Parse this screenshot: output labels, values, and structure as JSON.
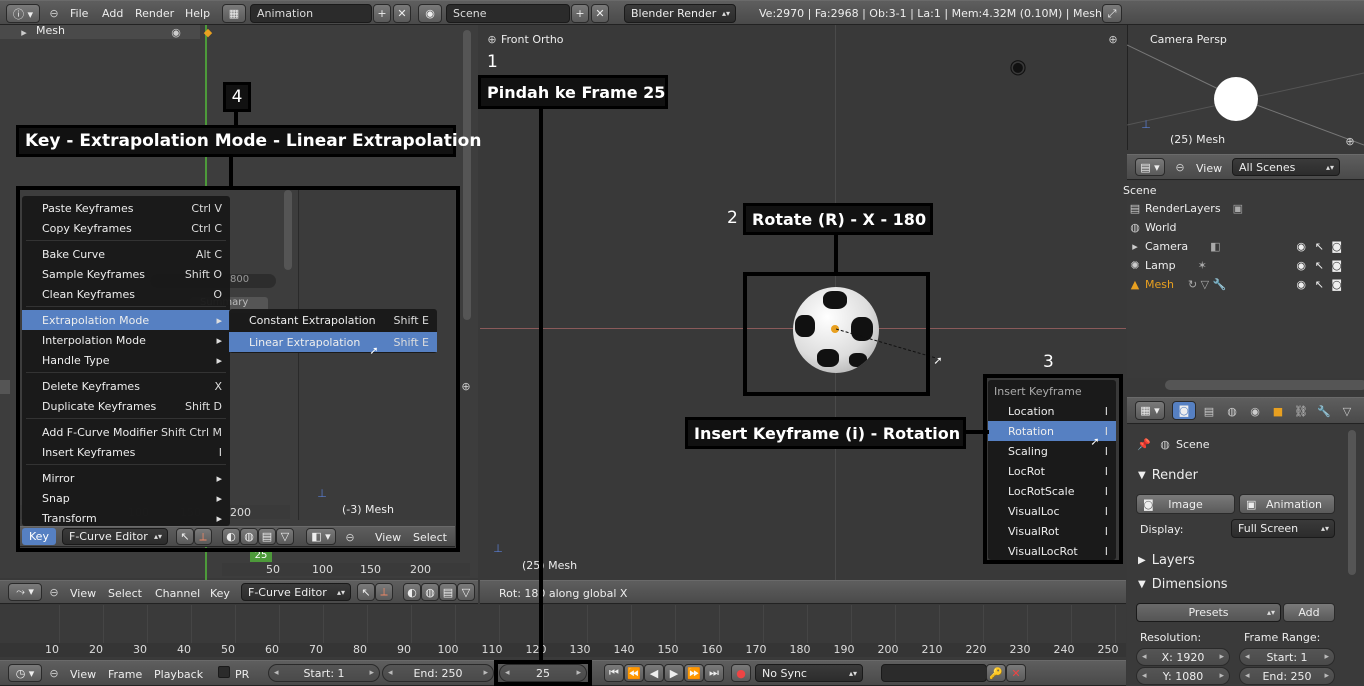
{
  "topbar": {
    "menus": [
      "File",
      "Add",
      "Render",
      "Help"
    ],
    "screen_layout": "Animation",
    "scene": "Scene",
    "engine": "Blender Render",
    "stats": "Ve:2970 | Fa:2968 | Ob:3-1 | La:1 | Mem:4.32M (0.10M) | Mesh"
  },
  "graph_editor": {
    "outliner_item": "Mesh",
    "left_label": "(-3) Mesh",
    "small_ticks_a": [
      "100",
      "150",
      "200"
    ],
    "small_fields": [
      "800",
      "Summary"
    ],
    "header": {
      "key_label": "Key",
      "editor_type": "F-Curve Editor",
      "menus": [
        "View",
        "Select"
      ]
    },
    "main_header": {
      "menus": [
        "View",
        "Select",
        "Channel",
        "Key"
      ],
      "editor_type": "F-Curve Editor"
    },
    "ruler": [
      "50",
      "100",
      "150",
      "200"
    ],
    "current_frame_badge": "25"
  },
  "key_menu": {
    "items": [
      {
        "label": "Paste Keyframes",
        "shortcut": "Ctrl V"
      },
      {
        "label": "Copy Keyframes",
        "shortcut": "Ctrl C"
      },
      {
        "label": "Bake Curve",
        "shortcut": "Alt C"
      },
      {
        "label": "Sample Keyframes",
        "shortcut": "Shift O"
      },
      {
        "label": "Clean Keyframes",
        "shortcut": "O"
      },
      {
        "label": "Extrapolation Mode",
        "shortcut": ""
      },
      {
        "label": "Interpolation Mode",
        "shortcut": ""
      },
      {
        "label": "Handle Type",
        "shortcut": ""
      },
      {
        "label": "Delete Keyframes",
        "shortcut": "X"
      },
      {
        "label": "Duplicate Keyframes",
        "shortcut": "Shift D"
      },
      {
        "label": "Add F-Curve Modifier",
        "shortcut": "Shift Ctrl M"
      },
      {
        "label": "Insert Keyframes",
        "shortcut": "I"
      },
      {
        "label": "Mirror",
        "shortcut": ""
      },
      {
        "label": "Snap",
        "shortcut": ""
      },
      {
        "label": "Transform",
        "shortcut": ""
      }
    ],
    "submenu": [
      {
        "label": "Constant Extrapolation",
        "shortcut": "Shift E"
      },
      {
        "label": "Linear Extrapolation",
        "shortcut": "Shift E"
      }
    ]
  },
  "viewport": {
    "title": "Front Ortho",
    "object_label": "(25) Mesh",
    "status": "Rot: 180  along global X"
  },
  "insert_keyframe_menu": {
    "title": "Insert Keyframe",
    "items": [
      {
        "label": "Location",
        "shortcut": "I"
      },
      {
        "label": "Rotation",
        "shortcut": "I"
      },
      {
        "label": "Scaling",
        "shortcut": "I"
      },
      {
        "label": "LocRot",
        "shortcut": "I"
      },
      {
        "label": "LocRotScale",
        "shortcut": "I"
      },
      {
        "label": "VisualLoc",
        "shortcut": "I"
      },
      {
        "label": "VisualRot",
        "shortcut": "I"
      },
      {
        "label": "VisualLocRot",
        "shortcut": "I"
      }
    ]
  },
  "callouts": {
    "c1_num": "1",
    "c1": "Pindah ke Frame 25",
    "c2_num": "2",
    "c2": "Rotate (R) - X - 180",
    "c3_num": "3",
    "c3": "Insert Keyframe (i) - Rotation",
    "c4_num": "4",
    "c4": "Key - Extrapolation Mode - Linear Extrapolation"
  },
  "camera_view": {
    "title": "Camera Persp",
    "label": "(25) Mesh"
  },
  "outliner": {
    "view": "View",
    "filter": "All Scenes",
    "scene": "Scene",
    "items": [
      "RenderLayers",
      "World",
      "Camera",
      "Lamp",
      "Mesh"
    ]
  },
  "properties": {
    "scene": "Scene",
    "render_panel": "Render",
    "image_btn": "Image",
    "animation_btn": "Animation",
    "display_label": "Display:",
    "display_value": "Full Screen",
    "layers_panel": "Layers",
    "dimensions_panel": "Dimensions",
    "presets": "Presets",
    "add": "Add",
    "resolution_label": "Resolution:",
    "frame_range_label": "Frame Range:",
    "res_x": "X: 1920",
    "res_y": "Y: 1080",
    "start_frame": "Start: 1",
    "end_frame": "End: 250"
  },
  "timeline": {
    "ticks": [
      "10",
      "20",
      "30",
      "40",
      "50",
      "60",
      "70",
      "80",
      "90",
      "100",
      "110",
      "120",
      "130",
      "140",
      "150",
      "160",
      "170",
      "180",
      "190",
      "200",
      "210",
      "220",
      "230",
      "240",
      "250"
    ],
    "menus": [
      "View",
      "Frame",
      "Playback"
    ],
    "pr": "PR",
    "start": "Start: 1",
    "end": "End: 250",
    "current": "25",
    "sync": "No Sync"
  }
}
